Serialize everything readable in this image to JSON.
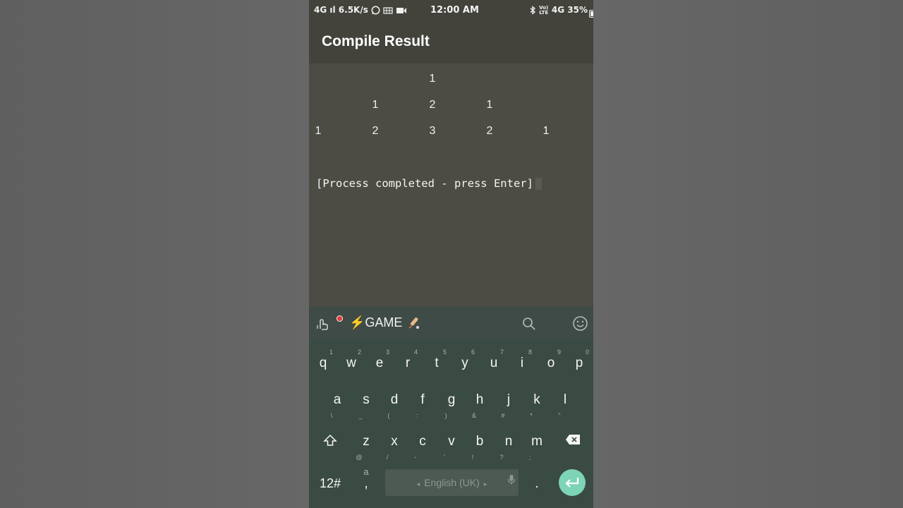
{
  "status_bar": {
    "left": "4G ıl  6.5K/s",
    "time": "12:00 AM",
    "right": "4G 35%",
    "volte": "VoLTE"
  },
  "app_bar": {
    "title": "Compile Result"
  },
  "output": {
    "rows": [
      [
        "1"
      ],
      [
        "1",
        "2",
        "1"
      ],
      [
        "1",
        "2",
        "3",
        "2",
        "1"
      ]
    ],
    "process_message": "[Process completed - press Enter]"
  },
  "keyboard_toolbar": {
    "game_label": "⚡GAME"
  },
  "keyboard": {
    "row1": [
      {
        "key": "q",
        "hint": "1"
      },
      {
        "key": "w",
        "hint": "2"
      },
      {
        "key": "e",
        "hint": "3"
      },
      {
        "key": "r",
        "hint": "4"
      },
      {
        "key": "t",
        "hint": "5"
      },
      {
        "key": "y",
        "hint": "6"
      },
      {
        "key": "u",
        "hint": "7"
      },
      {
        "key": "i",
        "hint": "8"
      },
      {
        "key": "o",
        "hint": "9"
      },
      {
        "key": "p",
        "hint": "0"
      }
    ],
    "row2": [
      {
        "key": "a",
        "hint": "\\"
      },
      {
        "key": "s",
        "hint": "_"
      },
      {
        "key": "d",
        "hint": "("
      },
      {
        "key": "f",
        "hint": ":"
      },
      {
        "key": "g",
        "hint": ")"
      },
      {
        "key": "h",
        "hint": "&"
      },
      {
        "key": "j",
        "hint": "#"
      },
      {
        "key": "k",
        "hint": "*"
      },
      {
        "key": "l",
        "hint": "\""
      }
    ],
    "row3": [
      {
        "key": "z",
        "hint": "@"
      },
      {
        "key": "x",
        "hint": "/"
      },
      {
        "key": "c",
        "hint": "-"
      },
      {
        "key": "v",
        "hint": "'"
      },
      {
        "key": "b",
        "hint": "!"
      },
      {
        "key": "n",
        "hint": "?"
      },
      {
        "key": "m",
        "hint": ";"
      }
    ],
    "numbers_key": "12#",
    "comma_key": ",",
    "comma_hint": "a",
    "space_label": "English (UK)",
    "period_key": "."
  },
  "colors": {
    "accent_enter": "#7ed4b6",
    "record_dot": "#e53935"
  }
}
